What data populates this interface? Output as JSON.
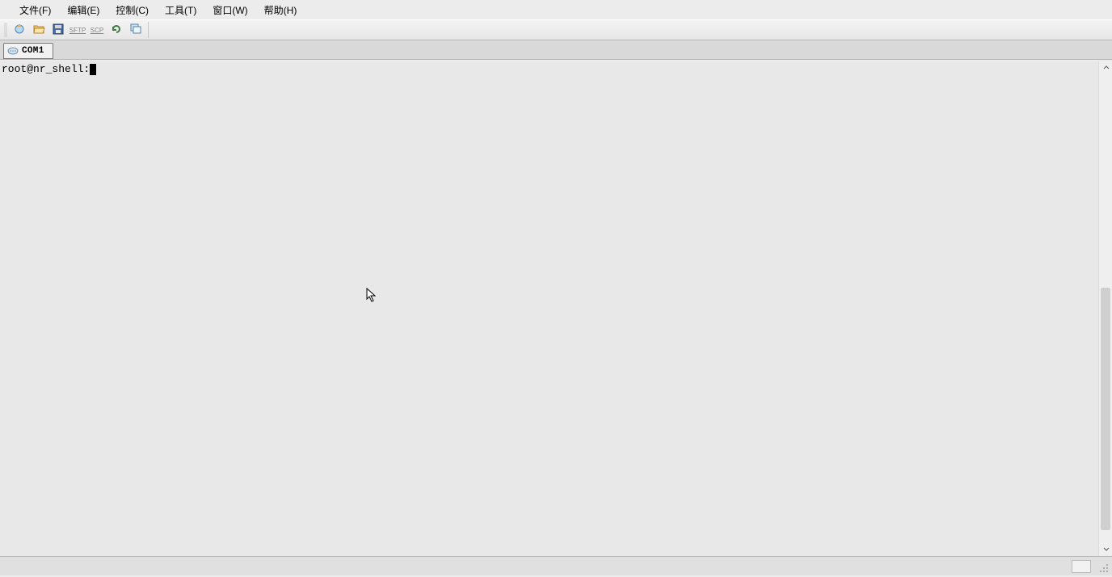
{
  "menu": {
    "file": "文件(F)",
    "edit": "编辑(E)",
    "control": "控制(C)",
    "tool": "工具(T)",
    "window": "窗口(W)",
    "help": "帮助(H)"
  },
  "toolbar": {
    "sftp_label": "SFTP",
    "scp_label": "SCP"
  },
  "tabs": [
    {
      "label": "COM1"
    }
  ],
  "terminal": {
    "prompt": "root@nr_shell:"
  }
}
